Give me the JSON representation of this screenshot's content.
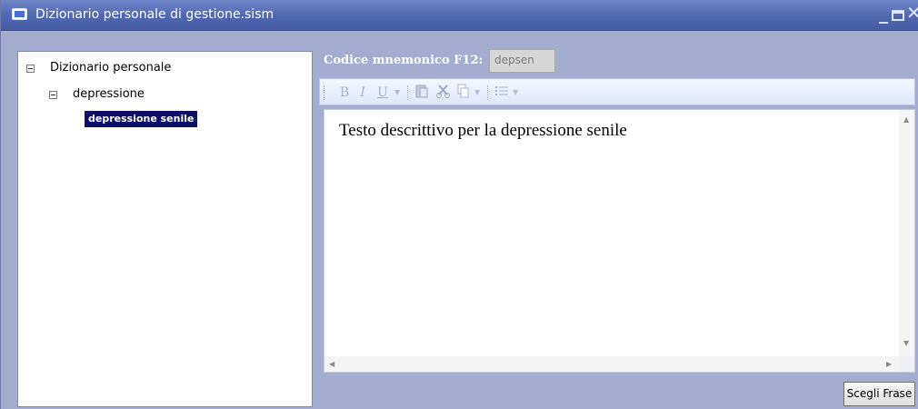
{
  "window": {
    "title": "Dizionario personale di gestione.sism",
    "min_glyph": "_",
    "close_glyph": "✕"
  },
  "tree": {
    "root_label": "Dizionario personale",
    "child_label": "depressione",
    "leaf_label": "depressione senile",
    "selected_bg": "#0b0f68"
  },
  "mnemonic": {
    "label": "Codice mnemonico F12:",
    "value": "depsen"
  },
  "toolbar": {
    "bold": "B",
    "italic": "I",
    "underline": "U",
    "icons": [
      "bold-icon",
      "italic-icon",
      "underline-icon",
      "paste-icon",
      "cut-icon",
      "copy-icon",
      "list-icon"
    ]
  },
  "editor": {
    "text": "Testo descrittivo per la depressione senile"
  },
  "buttons": {
    "choose_phrase": "Scegli Frase"
  },
  "colors": {
    "window_bg": "#a3adcf",
    "titlebar": "#4f66b1"
  }
}
